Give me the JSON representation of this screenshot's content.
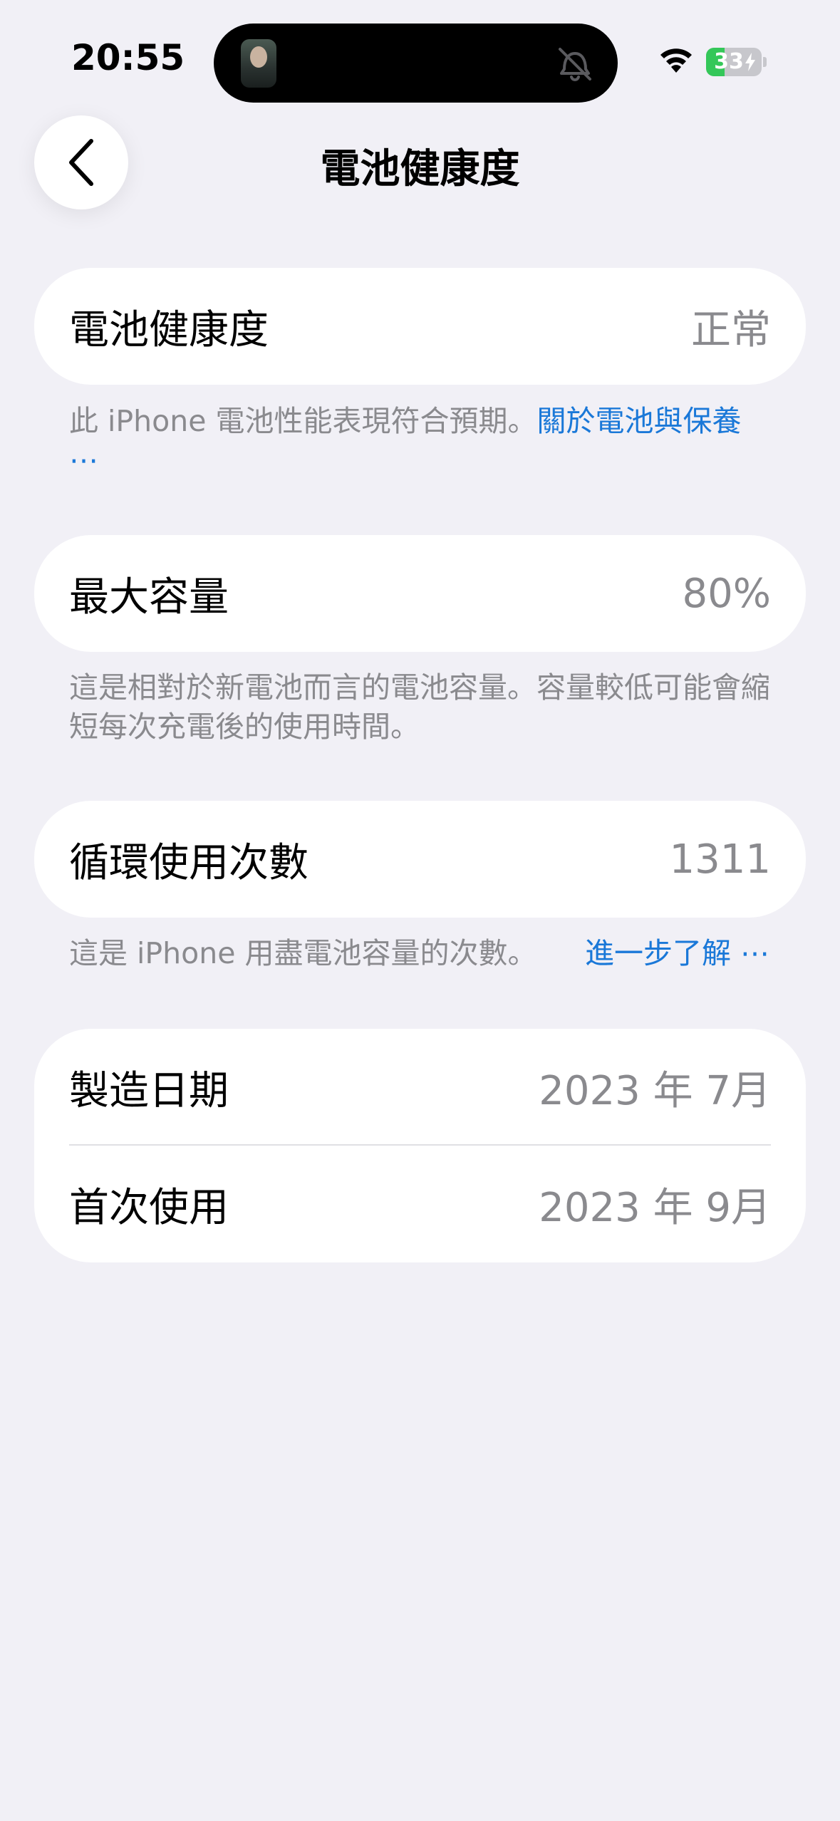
{
  "status_bar": {
    "time": "20:55",
    "battery_percent": "33",
    "battery_level": 0.33,
    "battery_fill_color": "#34c759",
    "charging": true
  },
  "nav": {
    "back_icon": "chevron-left-icon",
    "title": "電池健康度"
  },
  "health": {
    "label": "電池健康度",
    "value": "正常",
    "note": "此 iPhone 電池性能表現符合預期。",
    "note_link": "關於電池與保養 ⋯"
  },
  "capacity": {
    "label": "最大容量",
    "value": "80%",
    "note": "這是相對於新電池而言的電池容量。容量較低可能會縮短每次充電後的使用時間。"
  },
  "cycles": {
    "label": "循環使用次數",
    "value": "1311",
    "note": "這是 iPhone 用盡電池容量的次數。",
    "note_link": "進一步了解 ⋯"
  },
  "dates": {
    "manufacture_label": "製造日期",
    "manufacture_value": "2023 年 7月",
    "first_use_label": "首次使用",
    "first_use_value": "2023 年 9月"
  },
  "colors": {
    "background": "#f1f0f6",
    "link": "#1a78d8",
    "secondary_text": "#8a8a8e"
  }
}
